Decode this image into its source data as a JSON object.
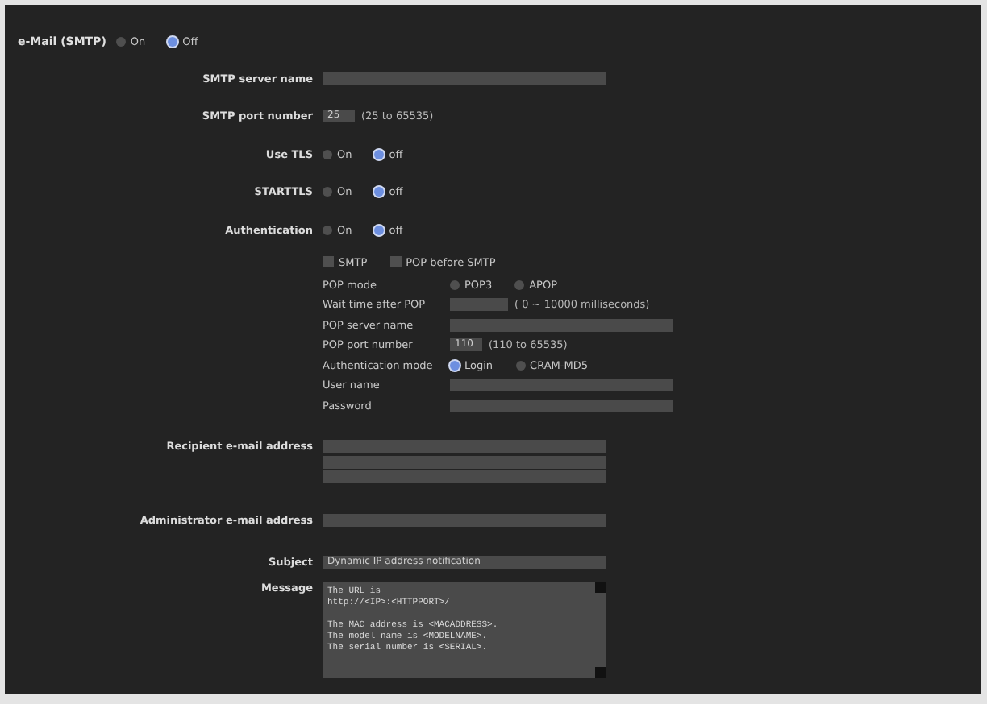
{
  "email_smtp": {
    "label": "e-Mail (SMTP)",
    "options": [
      {
        "label": "On",
        "selected": false
      },
      {
        "label": "Off",
        "selected": true
      }
    ]
  },
  "rows": [
    {
      "kind": "text",
      "label": "SMTP server name"
    },
    {
      "kind": "port",
      "label": "SMTP port number",
      "value": "25",
      "hint": "(25 to 65535)"
    },
    {
      "kind": "radio",
      "label": "Use TLS",
      "options": [
        {
          "label": "On",
          "selected": false
        },
        {
          "label": "off",
          "selected": true
        }
      ]
    },
    {
      "kind": "radio",
      "label": "STARTTLS",
      "options": [
        {
          "label": "On",
          "selected": false
        },
        {
          "label": "off",
          "selected": true
        }
      ]
    },
    {
      "kind": "radio",
      "label": "Authentication",
      "options": [
        {
          "label": "On",
          "selected": false
        },
        {
          "label": "off",
          "selected": true
        }
      ]
    }
  ],
  "auth_methods": [
    {
      "label": "SMTP",
      "checked": false
    },
    {
      "label": "POP before SMTP",
      "checked": false
    }
  ],
  "auth_rows": [
    {
      "kind": "radio",
      "label": "POP mode",
      "options": [
        {
          "label": "POP3",
          "selected": false
        },
        {
          "label": "APOP",
          "selected": false
        }
      ]
    },
    {
      "kind": "short",
      "label": "Wait time after POP",
      "hint": "( 0 ~ 10000 milliseconds)"
    },
    {
      "kind": "text",
      "label": "POP server name"
    },
    {
      "kind": "port",
      "label": "POP port number",
      "value": "110",
      "hint": "(110 to 65535)"
    },
    {
      "kind": "radio",
      "label": "Authentication mode",
      "options": [
        {
          "label": "Login",
          "selected": true
        },
        {
          "label": "CRAM-MD5",
          "selected": false
        }
      ]
    },
    {
      "kind": "text",
      "label": "User name"
    },
    {
      "kind": "text",
      "label": "Password"
    }
  ],
  "address_rows": [
    {
      "label": "Recipient e-mail address",
      "inputs": [
        {
          "kind": "text"
        },
        {
          "kind": "text"
        },
        {
          "kind": "text"
        }
      ]
    },
    {
      "label": "Administrator e-mail address",
      "inputs": [
        {
          "kind": "text"
        }
      ]
    }
  ],
  "subject": {
    "label": "Subject",
    "value": "Dynamic IP address notification"
  },
  "message": {
    "label": "Message",
    "paragraphs": [
      [
        "The URL is",
        "http://<IP>:<HTTPPORT>/"
      ],
      [
        "The MAC address is <MACADDRESS>.",
        "The model name is <MODELNAME>.",
        "The serial number is <SERIAL>."
      ]
    ]
  }
}
